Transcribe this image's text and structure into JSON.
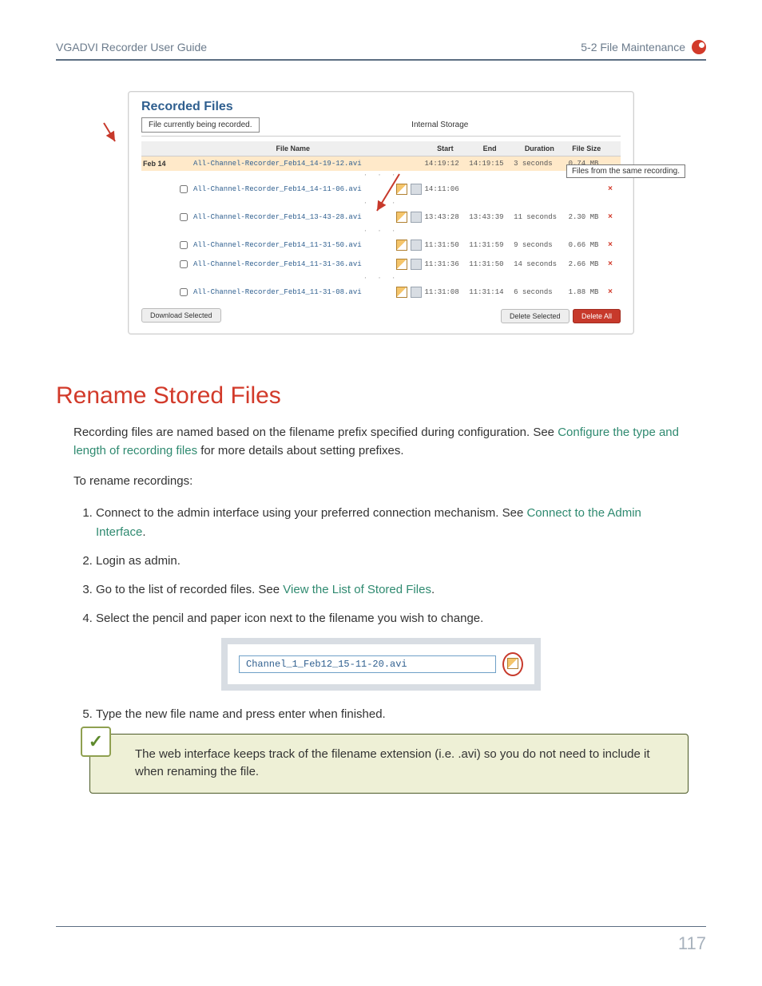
{
  "header": {
    "left": "VGADVI Recorder User Guide",
    "right": "5-2 File Maintenance"
  },
  "shot": {
    "title": "Recorded Files",
    "currently_recording": "File currently being recorded.",
    "storage": "Internal Storage",
    "columns": {
      "file": "File Name",
      "start": "Start",
      "end": "End",
      "duration": "Duration",
      "size": "File Size"
    },
    "date": "Feb 14",
    "callout": "Files from the same recording.",
    "rows": [
      {
        "hl": true,
        "file": "All-Channel-Recorder_Feb14_14-19-12.avi",
        "start": "14:19:12",
        "end": "14:19:15",
        "dur": "3 seconds",
        "size": "0.74 MB",
        "icons": false
      },
      {
        "hl": false,
        "file": "All-Channel-Recorder_Feb14_14-11-06.avi",
        "start": "14:11:06",
        "end": "",
        "dur": "",
        "size": "",
        "icons": true
      },
      {
        "hl": false,
        "file": "All-Channel-Recorder_Feb14_13-43-28.avi",
        "start": "13:43:28",
        "end": "13:43:39",
        "dur": "11 seconds",
        "size": "2.30 MB",
        "icons": true
      },
      {
        "hl": false,
        "file": "All-Channel-Recorder_Feb14_11-31-50.avi",
        "start": "11:31:50",
        "end": "11:31:59",
        "dur": "9 seconds",
        "size": "0.66 MB",
        "icons": true
      },
      {
        "hl": false,
        "file": "All-Channel-Recorder_Feb14_11-31-36.avi",
        "start": "11:31:36",
        "end": "11:31:50",
        "dur": "14 seconds",
        "size": "2.66 MB",
        "icons": true
      },
      {
        "hl": false,
        "file": "All-Channel-Recorder_Feb14_11-31-08.avi",
        "start": "11:31:08",
        "end": "11:31:14",
        "dur": "6 seconds",
        "size": "1.88 MB",
        "icons": true
      }
    ],
    "buttons": {
      "download": "Download Selected",
      "delete_sel": "Delete Selected",
      "delete_all": "Delete All"
    }
  },
  "section_title": "Rename Stored Files",
  "intro": {
    "pre": "Recording files are named based on the filename prefix specified during configuration. See ",
    "link": "Configure the type and length of recording files",
    "post": " for more details about setting prefixes."
  },
  "to_rename": "To rename recordings:",
  "steps": {
    "s1a": "Connect to the admin interface using your preferred connection mechanism. See ",
    "s1link": "Connect to the Admin Interface",
    "s1b": ".",
    "s2": "Login as admin.",
    "s3a": "Go to the list of recorded files. See ",
    "s3link": "View the List of Stored Files",
    "s3b": ".",
    "s4": "Select the pencil and paper icon next to the filename you wish to change.",
    "s5": "Type the new file name and press enter when finished."
  },
  "rename_field": "Channel_1_Feb12_15-11-20.avi",
  "tip": "The web interface keeps track of the filename extension (i.e. .avi) so you do not need to include it when renaming the file.",
  "page_number": "117"
}
